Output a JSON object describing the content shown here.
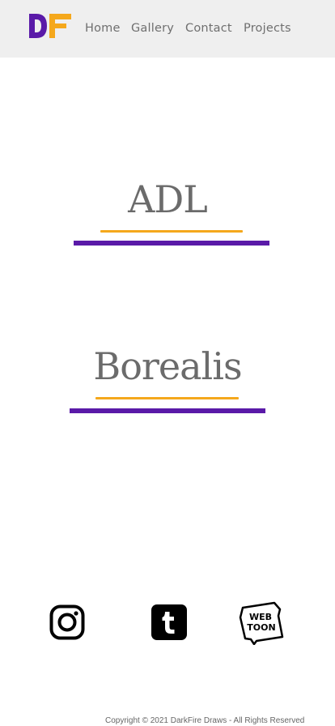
{
  "colors": {
    "navbar_bg": "#efefef",
    "nav_text": "#6f6f6f",
    "title_text": "#6b6b6b",
    "accent_orange": "#f5a81c",
    "accent_purple": "#5a1aa8",
    "icon_black": "#000000"
  },
  "logo": {
    "text": "DF",
    "icon": "darkfire-logo-icon"
  },
  "nav": {
    "items": [
      {
        "label": "Home"
      },
      {
        "label": "Gallery"
      },
      {
        "label": "Contact"
      },
      {
        "label": "Projects"
      }
    ]
  },
  "projects": [
    {
      "title": "ADL"
    },
    {
      "title": "Borealis"
    }
  ],
  "social": [
    {
      "icon": "instagram-icon"
    },
    {
      "icon": "tumblr-icon"
    },
    {
      "icon": "webtoon-icon",
      "text_line1": "WEB",
      "text_line2": "TOON"
    }
  ],
  "footer": {
    "copyright": "Copyright © 2021 DarkFire Draws - All Rights Reserved"
  }
}
